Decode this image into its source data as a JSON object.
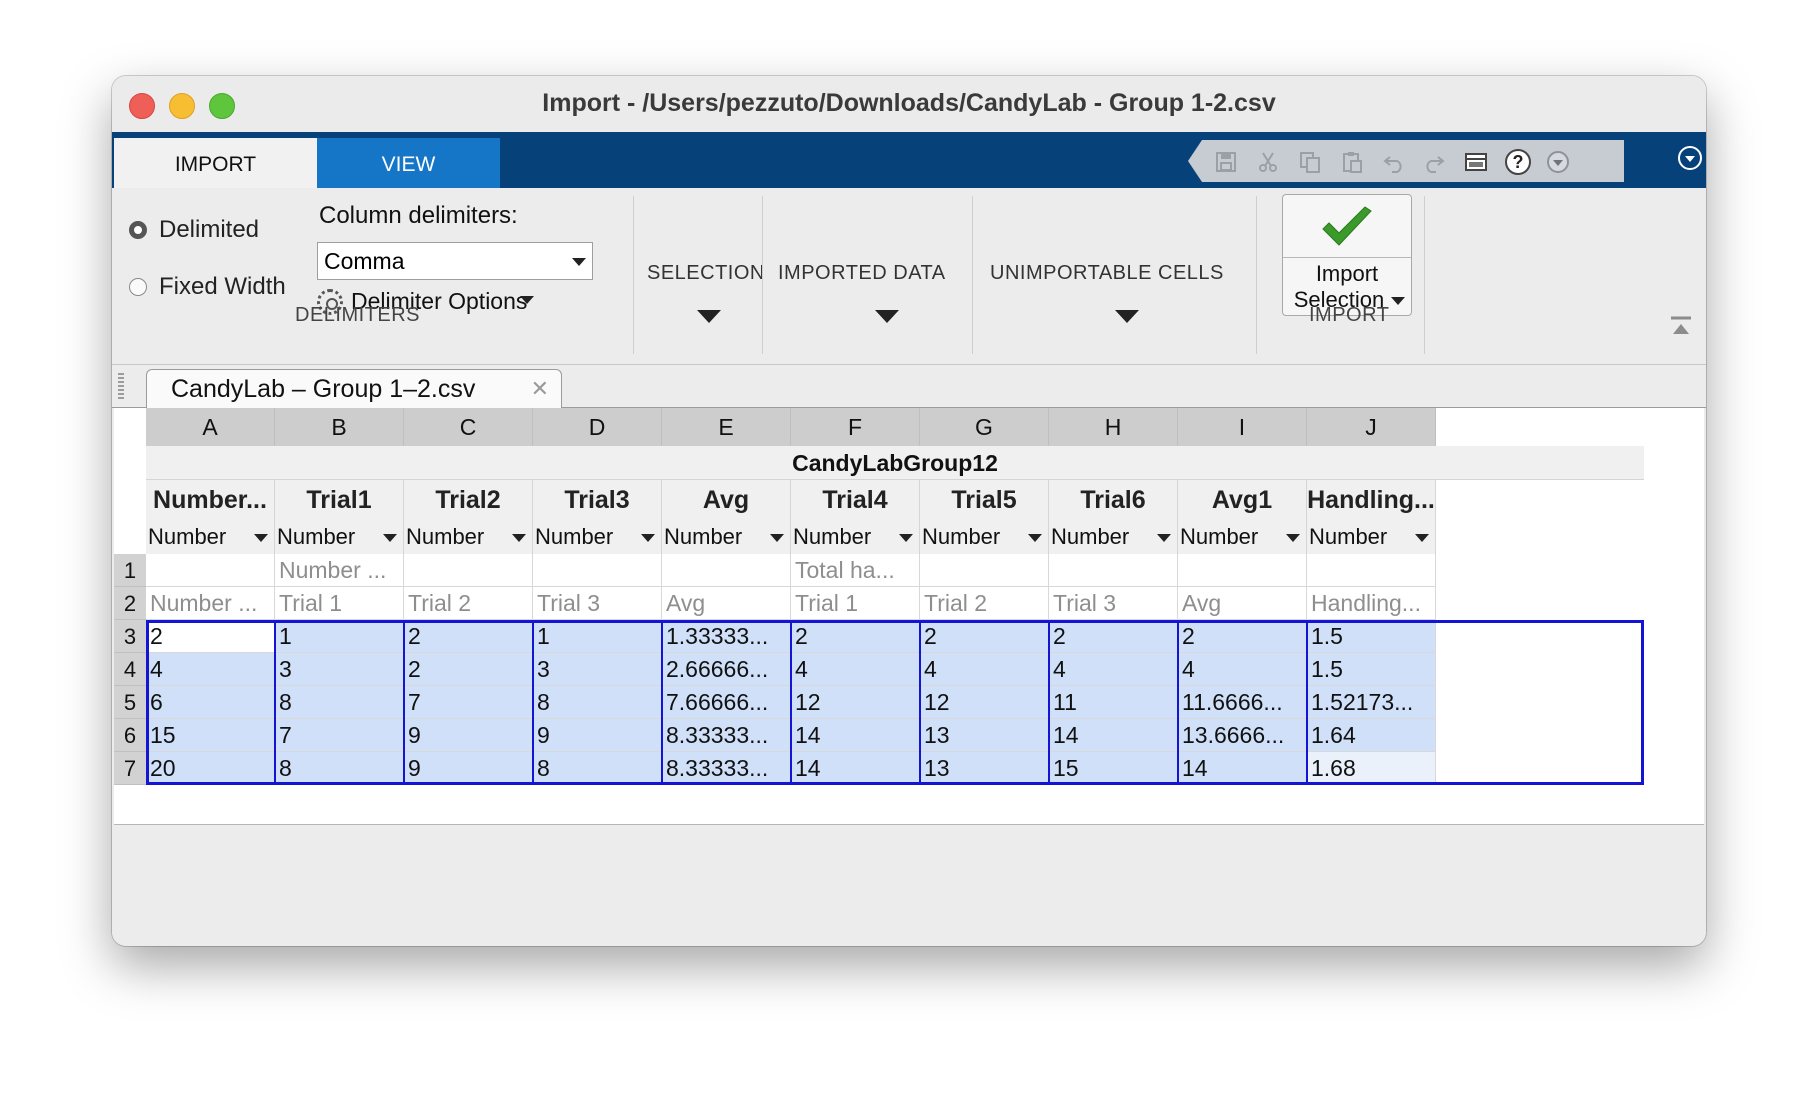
{
  "window": {
    "title": "Import - /Users/pezzuto/Downloads/CandyLab - Group 1-2.csv"
  },
  "ribbon_tabs": [
    {
      "label": "IMPORT"
    },
    {
      "label": "VIEW"
    }
  ],
  "quick_access_icons": [
    "save-icon",
    "cut-icon",
    "copy-icon",
    "paste-icon",
    "undo-icon",
    "redo-icon",
    "layout-icon",
    "help-icon",
    "more-icon"
  ],
  "delimiters": {
    "delimited_label": "Delimited",
    "fixed_width_label": "Fixed Width",
    "selected": "Delimited",
    "column_delimiters_label": "Column delimiters:",
    "column_delimiter_value": "Comma",
    "delimiter_options_label": "Delimiter Options",
    "group_label": "DELIMITERS"
  },
  "sections": {
    "selection": "SELECTION",
    "imported_data": "IMPORTED DATA",
    "unimportable_cells": "UNIMPORTABLE CELLS"
  },
  "import_group": {
    "button_line1": "Import",
    "button_line2": "Selection",
    "group_label": "IMPORT",
    "accent": "#3a9a2a"
  },
  "document_tab": {
    "label": "CandyLab – Group 1–2.csv"
  },
  "grid": {
    "table_name": "CandyLabGroup12",
    "columns": [
      {
        "letter": "A",
        "var": "Number...",
        "type": "Number"
      },
      {
        "letter": "B",
        "var": "Trial1",
        "type": "Number"
      },
      {
        "letter": "C",
        "var": "Trial2",
        "type": "Number"
      },
      {
        "letter": "D",
        "var": "Trial3",
        "type": "Number"
      },
      {
        "letter": "E",
        "var": "Avg",
        "type": "Number"
      },
      {
        "letter": "F",
        "var": "Trial4",
        "type": "Number"
      },
      {
        "letter": "G",
        "var": "Trial5",
        "type": "Number"
      },
      {
        "letter": "H",
        "var": "Trial6",
        "type": "Number"
      },
      {
        "letter": "I",
        "var": "Avg1",
        "type": "Number"
      },
      {
        "letter": "J",
        "var": "Handling...",
        "type": "Number"
      }
    ],
    "header_rows": [
      {
        "num": "1",
        "cells": [
          "",
          "Number ...",
          "",
          "",
          "",
          "Total ha...",
          "",
          "",
          "",
          ""
        ]
      },
      {
        "num": "2",
        "cells": [
          "Number ...",
          "Trial 1",
          "Trial 2",
          "Trial 3",
          "Avg",
          "Trial 1",
          "Trial 2",
          "Trial 3",
          "Avg",
          "Handling..."
        ]
      }
    ],
    "data_rows": [
      {
        "num": "3",
        "cells": [
          "2",
          "1",
          "2",
          "1",
          "1.33333...",
          "2",
          "2",
          "2",
          "2",
          "1.5"
        ]
      },
      {
        "num": "4",
        "cells": [
          "4",
          "3",
          "2",
          "3",
          "2.66666...",
          "4",
          "4",
          "4",
          "4",
          "1.5"
        ]
      },
      {
        "num": "5",
        "cells": [
          "6",
          "8",
          "7",
          "8",
          "7.66666...",
          "12",
          "12",
          "11",
          "11.6666...",
          "1.52173..."
        ]
      },
      {
        "num": "6",
        "cells": [
          "15",
          "7",
          "9",
          "9",
          "8.33333...",
          "14",
          "13",
          "14",
          "13.6666...",
          "1.64"
        ]
      },
      {
        "num": "7",
        "cells": [
          "20",
          "8",
          "9",
          "8",
          "8.33333...",
          "14",
          "13",
          "15",
          "14",
          "1.68"
        ]
      }
    ],
    "selection_color": "#1414d4",
    "selection_fill": "#cfe0f8"
  }
}
